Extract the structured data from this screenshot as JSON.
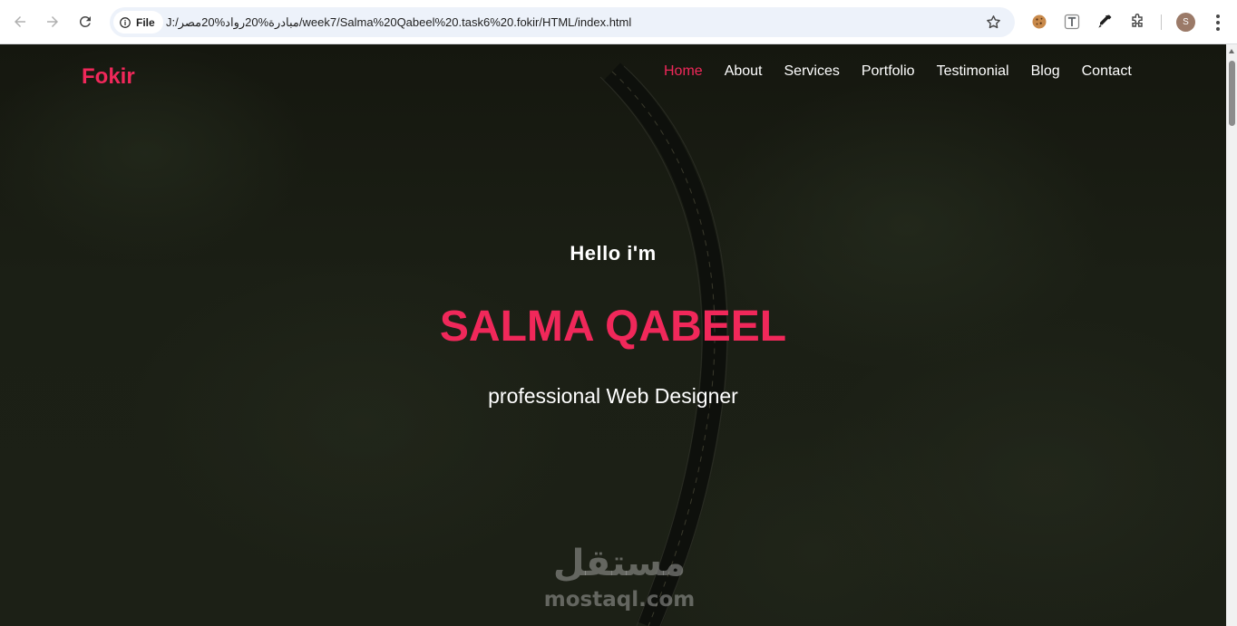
{
  "browser": {
    "security_chip_label": "File",
    "url": "J:/مبادرة%20رواد%20مصر/week7/Salma%20Qabeel%20.task6%20.fokir/HTML/index.html",
    "profile_initial": "S",
    "icons": {
      "back": "back-arrow-icon",
      "forward": "forward-arrow-icon",
      "reload": "reload-icon",
      "info": "info-icon",
      "bookmark": "star-icon",
      "ext1": "cookie-icon",
      "ext2": "text-font-icon",
      "ext3": "eyedropper-icon",
      "extensions": "puzzle-icon",
      "menu": "kebab-menu-icon"
    }
  },
  "site": {
    "logo": "Fokir",
    "nav": [
      {
        "label": "Home",
        "active": true
      },
      {
        "label": "About",
        "active": false
      },
      {
        "label": "Services",
        "active": false
      },
      {
        "label": "Portfolio",
        "active": false
      },
      {
        "label": "Testimonial",
        "active": false
      },
      {
        "label": "Blog",
        "active": false
      },
      {
        "label": "Contact",
        "active": false
      }
    ],
    "hero": {
      "greeting": "Hello i'm",
      "name": "SALMA QABEEL",
      "role": "professional Web Designer"
    },
    "watermark": {
      "arabic": "مستقل",
      "latin": "mostaql.com"
    }
  },
  "colors": {
    "accent": "#f0285a",
    "hero_overlay": "#1a1d16",
    "chrome_bg": "#ffffff",
    "omnibox_bg": "#edf2fa"
  }
}
